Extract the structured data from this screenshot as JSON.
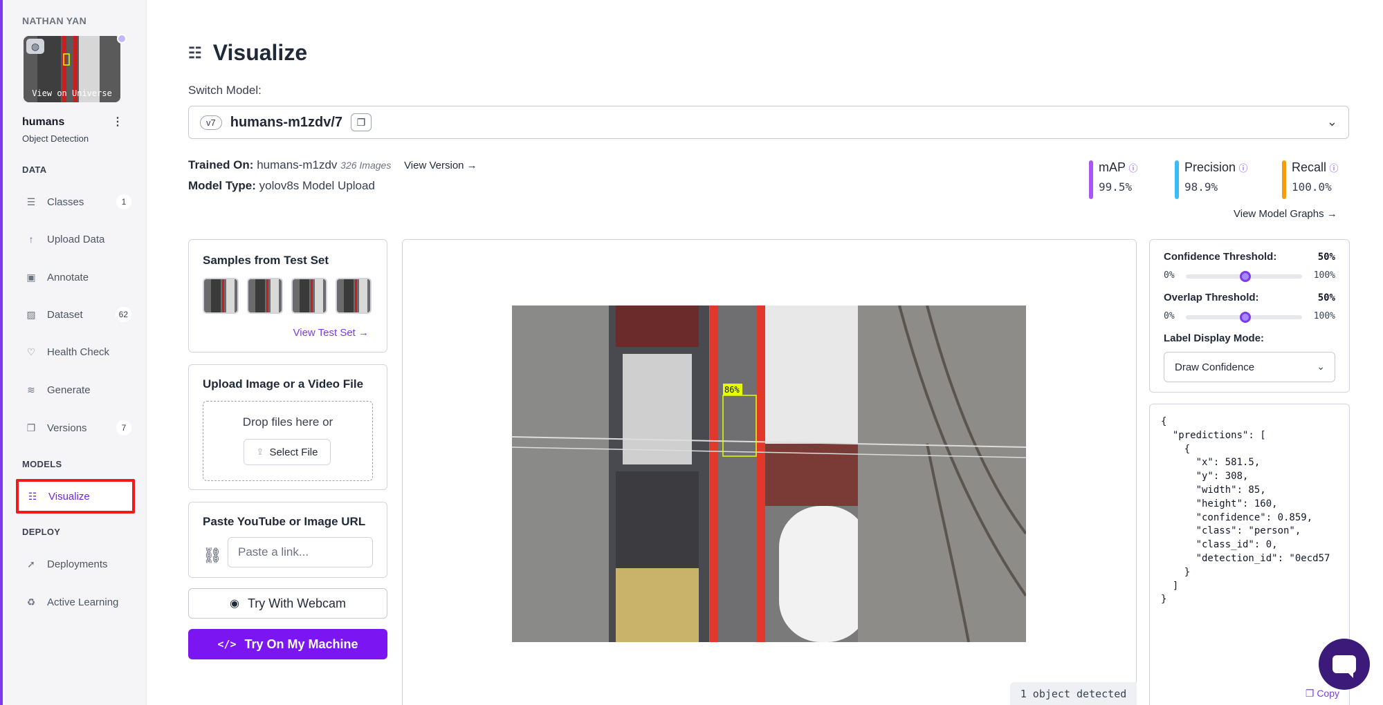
{
  "sidebar": {
    "workspace": "NATHAN YAN",
    "thumbnail_label": "View on Universe",
    "project_name": "humans",
    "project_menu": "⋮",
    "project_type": "Object Detection",
    "section_data": "DATA",
    "section_models": "MODELS",
    "section_deploy": "DEPLOY",
    "items": [
      {
        "label": "Classes",
        "badge": "1"
      },
      {
        "label": "Upload Data"
      },
      {
        "label": "Annotate"
      },
      {
        "label": "Dataset",
        "badge": "62"
      },
      {
        "label": "Health Check"
      },
      {
        "label": "Generate"
      },
      {
        "label": "Versions",
        "badge": "7"
      },
      {
        "label": "Visualize"
      },
      {
        "label": "Deployments"
      },
      {
        "label": "Active Learning"
      }
    ]
  },
  "header": {
    "title": "Visualize",
    "switch_label": "Switch Model:",
    "version_tag": "v7",
    "model_name": "humans-m1zdv/7",
    "trained_on_label": "Trained On:",
    "trained_on_value": "humans-m1zdv",
    "images_count": "326 Images",
    "view_version": "View Version →",
    "model_type_label": "Model Type:",
    "model_type_value": "yolov8s Model Upload",
    "view_graphs": "View Model Graphs →"
  },
  "metrics": [
    {
      "label": "mAP",
      "value": "99.5%",
      "color": "#a855f7"
    },
    {
      "label": "Precision",
      "value": "98.9%",
      "color": "#38bdf8"
    },
    {
      "label": "Recall",
      "value": "100.0%",
      "color": "#f59e0b"
    }
  ],
  "samples": {
    "title": "Samples from Test Set",
    "link": "View Test Set →"
  },
  "upload": {
    "title": "Upload Image or a Video File",
    "drop_text": "Drop files here or",
    "button": "Select File"
  },
  "url": {
    "title": "Paste YouTube or Image URL",
    "placeholder": "Paste a link..."
  },
  "buttons": {
    "webcam": "Try With Webcam",
    "machine": "Try On My Machine"
  },
  "viewer": {
    "detection_label": "86%",
    "status": "1 object detected"
  },
  "controls": {
    "confidence_label": "Confidence Threshold:",
    "confidence_value": "50%",
    "confidence_level": 0.5,
    "overlap_label": "Overlap Threshold:",
    "overlap_value": "50%",
    "overlap_level": 0.5,
    "min": "0%",
    "max": "100%",
    "mode_label": "Label Display Mode:",
    "mode_value": "Draw Confidence"
  },
  "json_output": "{\n  \"predictions\": [\n    {\n      \"x\": 581.5,\n      \"y\": 308,\n      \"width\": 85,\n      \"height\": 160,\n      \"confidence\": 0.859,\n      \"class\": \"person\",\n      \"class_id\": 0,\n      \"detection_id\": \"0ecd57\n    }\n  ]\n}",
  "copy_label": "Copy",
  "colors": {
    "accent": "#7b16f2",
    "highlight": "#ef1b1b",
    "box": "#e5ff00"
  }
}
